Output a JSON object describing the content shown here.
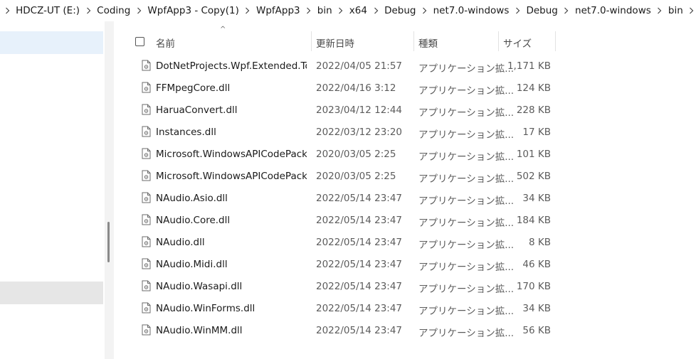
{
  "breadcrumb": [
    "HDCZ-UT (E:)",
    "Coding",
    "WpfApp3 - Copy(1)",
    "WpfApp3",
    "bin",
    "x64",
    "Debug",
    "net7.0-windows",
    "Debug",
    "net7.0-windows",
    "bin"
  ],
  "columns": {
    "name": "名前",
    "date": "更新日時",
    "type": "種類",
    "size": "サイズ"
  },
  "files": [
    {
      "name": "DotNetProjects.Wpf.Extended.To...",
      "date": "2022/04/05 21:57",
      "type": "アプリケーション拡...",
      "size": "1,171 KB"
    },
    {
      "name": "FFMpegCore.dll",
      "date": "2022/04/16 3:12",
      "type": "アプリケーション拡...",
      "size": "124 KB"
    },
    {
      "name": "HaruaConvert.dll",
      "date": "2023/04/12 12:44",
      "type": "アプリケーション拡...",
      "size": "228 KB"
    },
    {
      "name": "Instances.dll",
      "date": "2022/03/12 23:20",
      "type": "アプリケーション拡...",
      "size": "17 KB"
    },
    {
      "name": "Microsoft.WindowsAPICodePack....",
      "date": "2020/03/05 2:25",
      "type": "アプリケーション拡...",
      "size": "101 KB"
    },
    {
      "name": "Microsoft.WindowsAPICodePack....",
      "date": "2020/03/05 2:25",
      "type": "アプリケーション拡...",
      "size": "502 KB"
    },
    {
      "name": "NAudio.Asio.dll",
      "date": "2022/05/14 23:47",
      "type": "アプリケーション拡...",
      "size": "34 KB"
    },
    {
      "name": "NAudio.Core.dll",
      "date": "2022/05/14 23:47",
      "type": "アプリケーション拡...",
      "size": "184 KB"
    },
    {
      "name": "NAudio.dll",
      "date": "2022/05/14 23:47",
      "type": "アプリケーション拡...",
      "size": "8 KB"
    },
    {
      "name": "NAudio.Midi.dll",
      "date": "2022/05/14 23:47",
      "type": "アプリケーション拡...",
      "size": "46 KB"
    },
    {
      "name": "NAudio.Wasapi.dll",
      "date": "2022/05/14 23:47",
      "type": "アプリケーション拡...",
      "size": "170 KB"
    },
    {
      "name": "NAudio.WinForms.dll",
      "date": "2022/05/14 23:47",
      "type": "アプリケーション拡...",
      "size": "34 KB"
    },
    {
      "name": "NAudio.WinMM.dll",
      "date": "2022/05/14 23:47",
      "type": "アプリケーション拡...",
      "size": "56 KB"
    }
  ],
  "icons": {
    "breadcrumb_separator": "chevron-right-icon",
    "file": "dll-file-icon",
    "sort": "sort-up-icon"
  },
  "colors": {
    "nav_selected": "#e7f1fb",
    "nav_hover": "#e6e6e6"
  }
}
